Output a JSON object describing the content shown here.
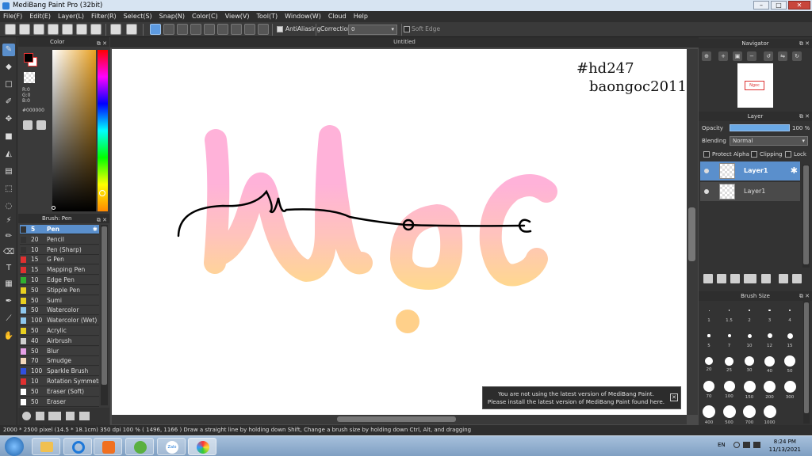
{
  "window": {
    "title": "MediBang Paint Pro (32bit)",
    "min": "–",
    "max": "□",
    "close": "✕"
  },
  "menu": [
    "File(F)",
    "Edit(E)",
    "Layer(L)",
    "Filter(R)",
    "Select(S)",
    "Snap(N)",
    "Color(C)",
    "View(V)",
    "Tool(T)",
    "Window(W)",
    "Cloud",
    "Help"
  ],
  "toolbar": {
    "antialiasing_label": "AntiAliasing",
    "correction_label": "Correction",
    "correction_value": "0",
    "soft_edge_label": "Soft Edge"
  },
  "color_panel": {
    "title": "Color",
    "r": "R:0",
    "g": "G:0",
    "b": "B:0",
    "hex": "#000000"
  },
  "brush_panel": {
    "title": "Brush: Pen",
    "items": [
      {
        "size": "5",
        "name": "Pen",
        "color": "#333333"
      },
      {
        "size": "20",
        "name": "Pencil",
        "color": "#333333"
      },
      {
        "size": "10",
        "name": "Pen (Sharp)",
        "color": "#333333"
      },
      {
        "size": "15",
        "name": "G Pen",
        "color": "#e03030"
      },
      {
        "size": "15",
        "name": "Mapping Pen",
        "color": "#e03030"
      },
      {
        "size": "10",
        "name": "Edge Pen",
        "color": "#30b030"
      },
      {
        "size": "50",
        "name": "Stipple Pen",
        "color": "#e8d020"
      },
      {
        "size": "50",
        "name": "Sumi",
        "color": "#e8d020"
      },
      {
        "size": "50",
        "name": "Watercolor",
        "color": "#8ec8ee"
      },
      {
        "size": "100",
        "name": "Watercolor (Wet)",
        "color": "#8ec8ee"
      },
      {
        "size": "50",
        "name": "Acrylic",
        "color": "#e8d020"
      },
      {
        "size": "40",
        "name": "Airbrush",
        "color": "#cfcfcf"
      },
      {
        "size": "50",
        "name": "Blur",
        "color": "#e6a0e6"
      },
      {
        "size": "70",
        "name": "Smudge",
        "color": "#f4d8bc"
      },
      {
        "size": "100",
        "name": "Sparkle Brush",
        "color": "#3050e0"
      },
      {
        "size": "10",
        "name": "Rotation Symmetry",
        "color": "#e03030"
      },
      {
        "size": "50",
        "name": "Eraser (Soft)",
        "color": "#ffffff"
      },
      {
        "size": "50",
        "name": "Eraser",
        "color": "#ffffff"
      }
    ]
  },
  "document": {
    "tab": "Untitled",
    "watermark_1": "#hd247",
    "watermark_2": "baongoc2011"
  },
  "notification": {
    "line1": "You are not using the latest version of MediBang Paint.",
    "line2": "Please install the latest version of MediBang Paint found here.",
    "close": "✕"
  },
  "navigator": {
    "title": "Navigator",
    "thumb_label": "Ngoc"
  },
  "layer_panel": {
    "title": "Layer",
    "opacity_label": "Opacity",
    "opacity_value": "100 %",
    "blending_label": "Blending",
    "blending_value": "Normal",
    "protect_alpha": "Protect Alpha",
    "clipping": "Clipping",
    "lock": "Lock",
    "layers": [
      {
        "name": "Layer1"
      },
      {
        "name": "Layer1"
      }
    ]
  },
  "brush_size": {
    "title": "Brush Size",
    "sizes": [
      "1",
      "1.5",
      "2",
      "3",
      "4",
      "5",
      "7",
      "10",
      "12",
      "15",
      "20",
      "25",
      "30",
      "40",
      "50",
      "70",
      "100",
      "150",
      "200",
      "300",
      "400",
      "500",
      "700",
      "1000"
    ]
  },
  "status": {
    "text": "2000 * 2500 pixel   (14.5 * 18.1cm)   350 dpi   100 %   ( 1496, 1166 )   Draw a straight line by holding down Shift, Change a brush size by holding down Ctrl, Alt, and dragging"
  },
  "taskbar": {
    "lang": "EN",
    "time": "8:24 PM",
    "date": "11/13/2021",
    "zalo": "Zalo"
  }
}
